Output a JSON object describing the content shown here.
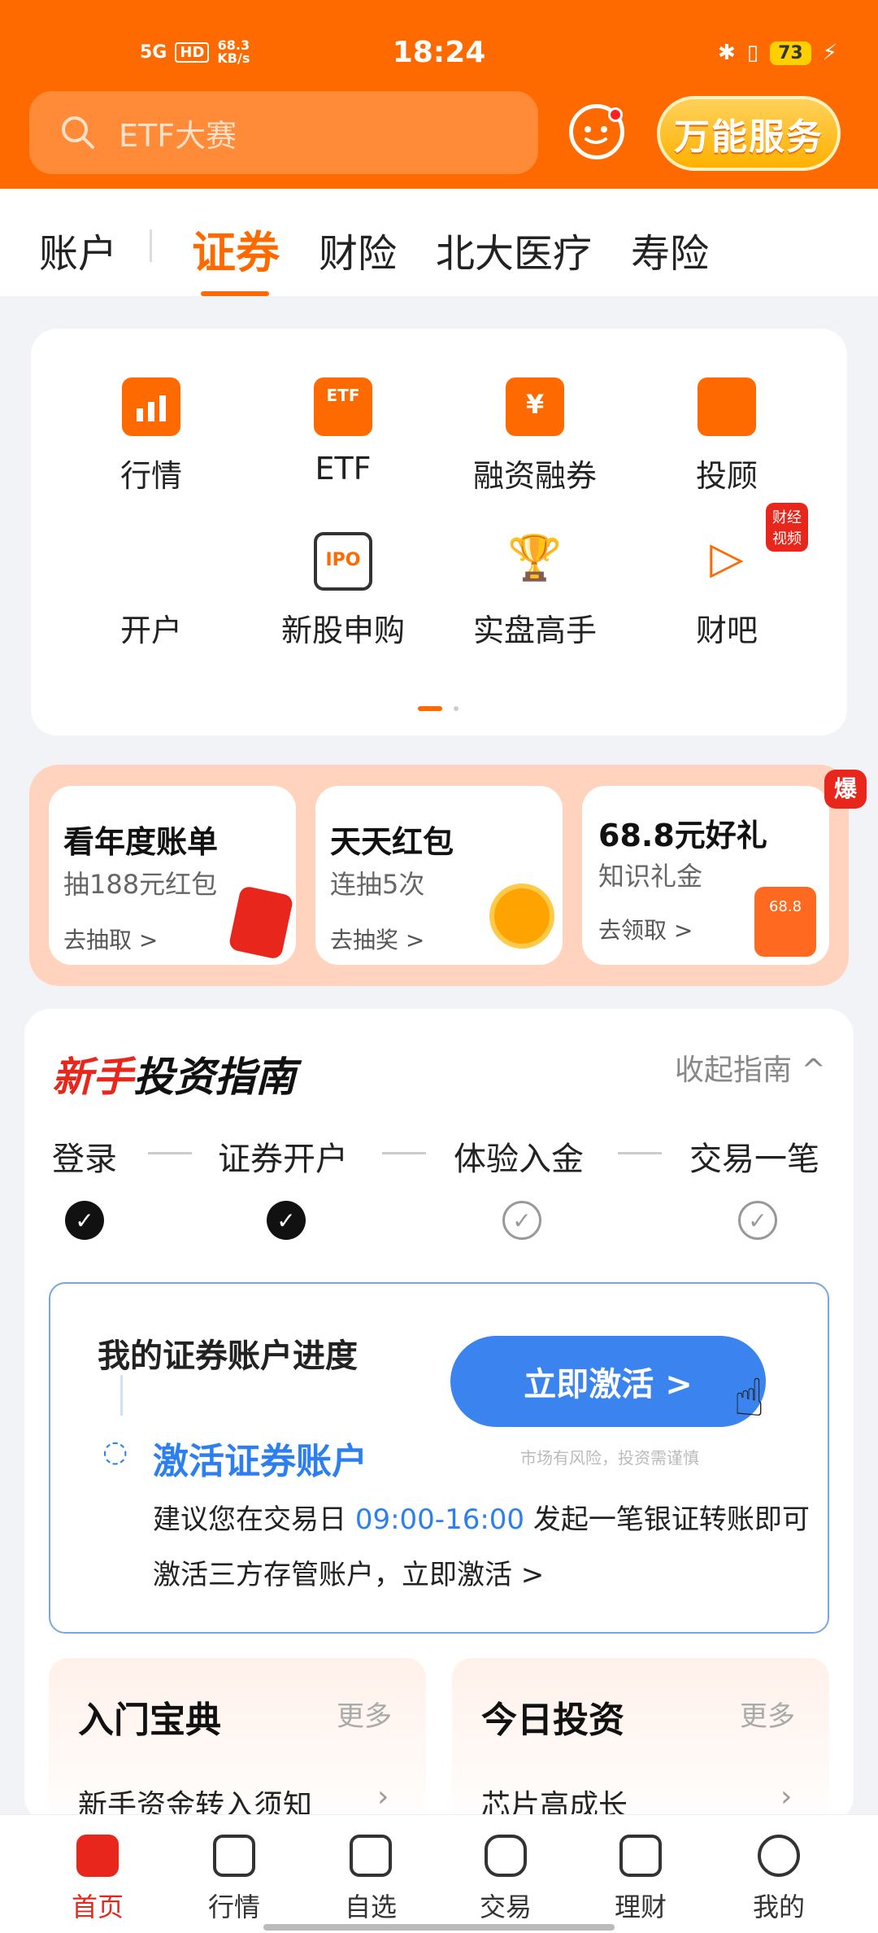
{
  "status_bar": {
    "time": "18:24",
    "network": "5G",
    "hd": "HD",
    "speed_value": "68.3",
    "speed_unit": "KB/s",
    "battery": "73"
  },
  "search": {
    "placeholder": "ETF大赛"
  },
  "header": {
    "service_button": "万能服务"
  },
  "tabs": [
    {
      "label": "账户"
    },
    {
      "label": "证券",
      "selected": true
    },
    {
      "label": "财险"
    },
    {
      "label": "北大医疗"
    },
    {
      "label": "寿险"
    }
  ],
  "grid": [
    {
      "label": "行情",
      "icon": "chart-icon"
    },
    {
      "label": "ETF",
      "icon": "etf-icon"
    },
    {
      "label": "融资融券",
      "icon": "yuan-icon"
    },
    {
      "label": "投顾",
      "icon": "advisor-icon"
    },
    {
      "label": "开户",
      "icon": ""
    },
    {
      "label": "新股申购",
      "icon": "ipo-icon"
    },
    {
      "label": "实盘高手",
      "icon": "trophy-icon"
    },
    {
      "label": "财吧",
      "icon": "play-icon",
      "badge": "财经视频"
    }
  ],
  "promos": [
    {
      "title": "看年度账单",
      "sub": "抽188元红包",
      "action": "去抽取 >"
    },
    {
      "title": "天天红包",
      "sub": "连抽5次",
      "action": "去抽奖 >"
    },
    {
      "title": "68.8元好礼",
      "sub": "知识礼金",
      "action": "去领取 >",
      "badge": "爆",
      "coupon": "68.8"
    }
  ],
  "guide": {
    "title_red": "新手",
    "title_black": "投资指南",
    "collapse": "收起指南 ^",
    "steps": [
      {
        "label": "登录",
        "done": true
      },
      {
        "label": "证券开户",
        "done": true
      },
      {
        "label": "体验入金",
        "done": false
      },
      {
        "label": "交易一笔",
        "done": false
      }
    ],
    "progress_title": "我的证券账户进度",
    "activate_button": "立即激活 >",
    "risk_note": "市场有风险，投资需谨慎",
    "activate_title": "激活证券账户",
    "desc_pre": "建议您在交易日 ",
    "desc_time": "09:00-16:00",
    "desc_post": " 发起一笔银证转账即可",
    "desc_line2": "激活三方存管账户，立即激活 >"
  },
  "sections": [
    {
      "title": "入门宝典",
      "more": "更多",
      "item": "新手资金转入须知"
    },
    {
      "title": "今日投资",
      "more": "更多",
      "item": "芯片高成长"
    }
  ],
  "nav": [
    {
      "label": "首页",
      "active": true
    },
    {
      "label": "行情"
    },
    {
      "label": "自选"
    },
    {
      "label": "交易"
    },
    {
      "label": "理财"
    },
    {
      "label": "我的"
    }
  ],
  "colors": {
    "brand": "#ff6a00",
    "accent_blue": "#2c7ff0",
    "red": "#e8261c"
  }
}
